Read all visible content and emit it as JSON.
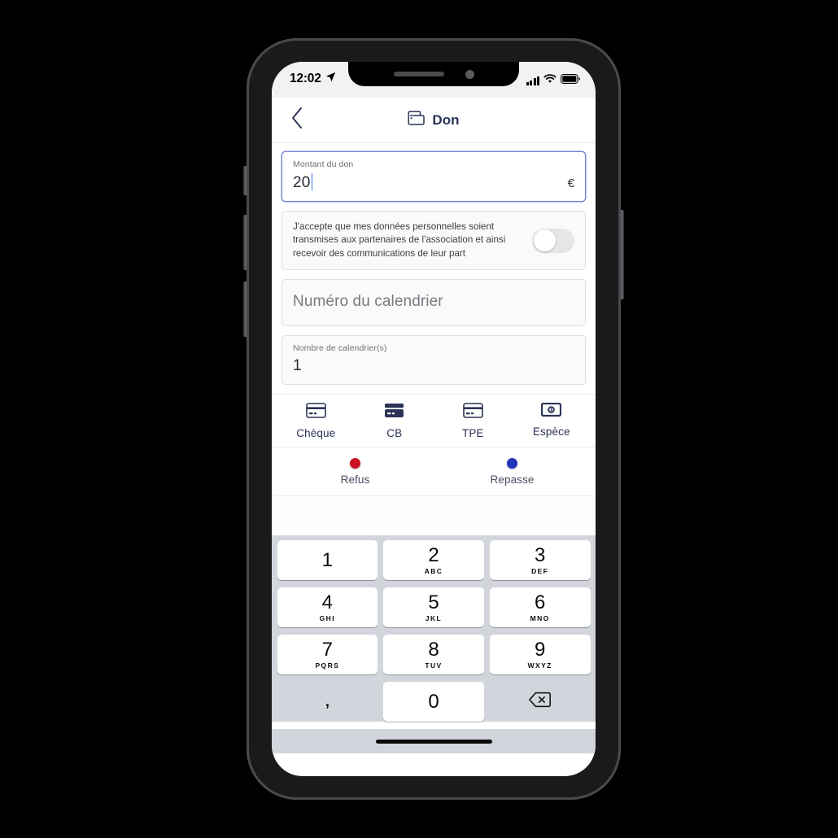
{
  "status_bar": {
    "time": "12:02",
    "location_icon": "location-arrow-icon",
    "signal_icon": "cellular-signal-icon",
    "wifi_icon": "wifi-icon",
    "battery_icon": "battery-icon"
  },
  "nav": {
    "back_icon": "chevron-left-icon",
    "title_icon": "wallet-icon",
    "title": "Don"
  },
  "form": {
    "amount": {
      "label": "Montant du don",
      "value": "20",
      "suffix": "€",
      "focused": true
    },
    "consent": {
      "text": "J'accepte que mes données personnelles soient transmises aux partenaires de l'association et ainsi recevoir des communications de leur part",
      "toggle_state": "off"
    },
    "calendar_number": {
      "placeholder": "Numéro du calendrier",
      "value": ""
    },
    "calendar_count": {
      "label": "Nombre de calendrier(s)",
      "value": "1"
    }
  },
  "payment_methods": [
    {
      "label": "Chèque",
      "icon": "credit-card-outline-icon",
      "selected": false
    },
    {
      "label": "CB",
      "icon": "credit-card-filled-icon",
      "selected": true
    },
    {
      "label": "TPE",
      "icon": "credit-card-outline-icon",
      "selected": false
    },
    {
      "label": "Espèce",
      "icon": "banknote-icon",
      "selected": false
    }
  ],
  "status_actions": [
    {
      "label": "Refus",
      "icon": "red-dot-icon",
      "color": "#cc1122"
    },
    {
      "label": "Repasse",
      "icon": "blue-dot-icon",
      "color": "#2233bb"
    }
  ],
  "keyboard": {
    "rows": [
      [
        {
          "digit": "1",
          "letters": ""
        },
        {
          "digit": "2",
          "letters": "ABC"
        },
        {
          "digit": "3",
          "letters": "DEF"
        }
      ],
      [
        {
          "digit": "4",
          "letters": "GHI"
        },
        {
          "digit": "5",
          "letters": "JKL"
        },
        {
          "digit": "6",
          "letters": "MNO"
        }
      ],
      [
        {
          "digit": "7",
          "letters": "PQRS"
        },
        {
          "digit": "8",
          "letters": "TUV"
        },
        {
          "digit": "9",
          "letters": "WXYZ"
        }
      ]
    ],
    "bottom": {
      "comma": ",",
      "zero": "0",
      "delete_icon": "backspace-delete-icon"
    }
  },
  "colors": {
    "accent": "#2b3356",
    "focus_border": "#7a86d6",
    "caret": "#4a76f0",
    "refus": "#cc1122",
    "repasse": "#2233bb",
    "keyboard_bg": "#d2d5db"
  }
}
